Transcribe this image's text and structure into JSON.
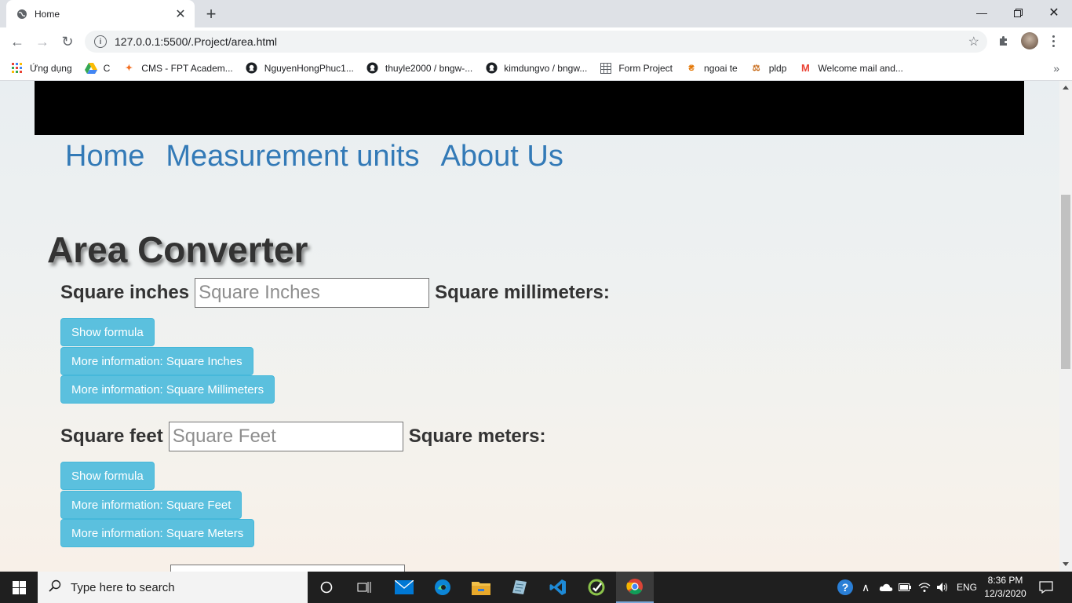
{
  "browser": {
    "tab_title": "Home",
    "url": "127.0.0.1:5500/.Project/area.html",
    "bookmarks": [
      {
        "label": "Ứng dụng",
        "icon": "apps-grid-icon"
      },
      {
        "label": "C",
        "icon": "google-drive-icon"
      },
      {
        "label": "CMS - FPT Academ...",
        "icon": "fpt-icon"
      },
      {
        "label": "NguyenHongPhuc1...",
        "icon": "github-icon"
      },
      {
        "label": "thuyle2000 / bngw-...",
        "icon": "github-icon"
      },
      {
        "label": "kimdungvo / bngw...",
        "icon": "github-icon"
      },
      {
        "label": "Form Project",
        "icon": "form-icon"
      },
      {
        "label": "ngoai te",
        "icon": "currency-icon"
      },
      {
        "label": "pldp",
        "icon": "bookmark-icon"
      },
      {
        "label": "Welcome mail and...",
        "icon": "gmail-icon"
      }
    ]
  },
  "site": {
    "nav": [
      "Home",
      "Measurement units",
      "About Us"
    ],
    "title": "Area Converter",
    "converters": [
      {
        "from_label": "Square inches",
        "placeholder": "Square Inches",
        "to_label": "Square millimeters:",
        "buttons": [
          "Show formula",
          "More information: Square Inches",
          "More information: Square Millimeters"
        ]
      },
      {
        "from_label": "Square feet",
        "placeholder": "Square Feet",
        "to_label": "Square meters:",
        "buttons": [
          "Show formula",
          "More information: Square Feet",
          "More information: Square Meters"
        ]
      }
    ]
  },
  "taskbar": {
    "search_placeholder": "Type here to search",
    "language": "ENG",
    "time": "8:36 PM",
    "date": "12/3/2020"
  }
}
